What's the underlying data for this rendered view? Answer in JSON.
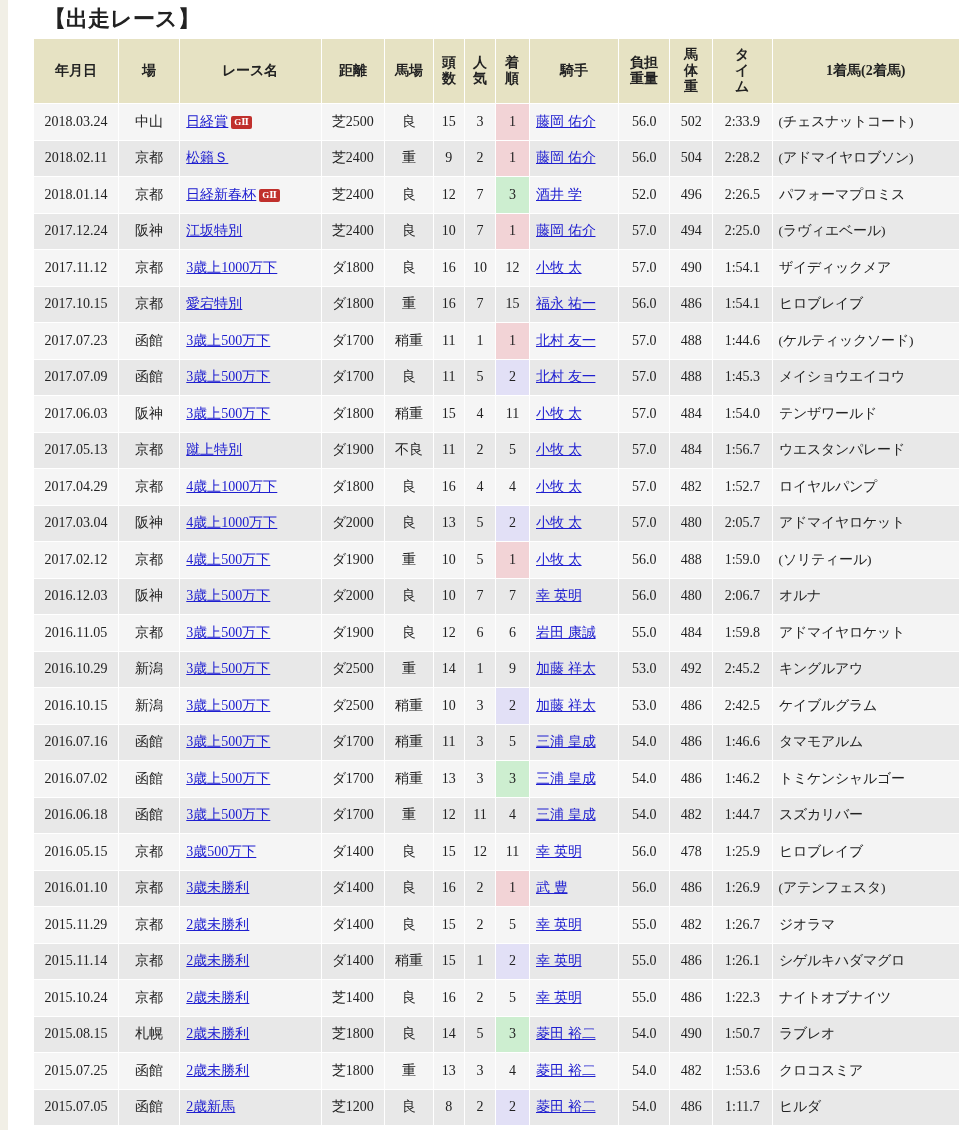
{
  "title": "【出走レース】",
  "columns": [
    "年月日",
    "場",
    "レース名",
    "距離",
    "馬場",
    "頭数",
    "人気",
    "着順",
    "騎手",
    "負担重量",
    "馬体重",
    "タイム",
    "1着馬(2着馬)"
  ],
  "rows": [
    {
      "date": "2018.03.24",
      "course": "中山",
      "race": "日経賞",
      "grade": "GⅡ",
      "distance": "芝2500",
      "track": "良",
      "runners": "15",
      "popularity": "3",
      "finish": {
        "text": "1",
        "color": "#f2d3d6"
      },
      "jockey": "藤岡 佑介",
      "weight": "56.0",
      "body_weight": "502",
      "time": "2:33.9",
      "winner": "(チェスナットコート)"
    },
    {
      "date": "2018.02.11",
      "course": "京都",
      "race": "松籟Ｓ",
      "distance": "芝2400",
      "track": "重",
      "runners": "9",
      "popularity": "2",
      "finish": {
        "text": "1",
        "color": "#f2d3d6"
      },
      "jockey": "藤岡 佑介",
      "weight": "56.0",
      "body_weight": "504",
      "time": "2:28.2",
      "winner": "(アドマイヤロブソン)"
    },
    {
      "date": "2018.01.14",
      "course": "京都",
      "race": "日経新春杯",
      "grade": "GⅡ",
      "distance": "芝2400",
      "track": "良",
      "runners": "12",
      "popularity": "7",
      "finish": {
        "text": "3",
        "color": "#cdeed0"
      },
      "jockey": "酒井 学",
      "weight": "52.0",
      "body_weight": "496",
      "time": "2:26.5",
      "winner": "パフォーマプロミス"
    },
    {
      "date": "2017.12.24",
      "course": "阪神",
      "race": "江坂特別",
      "distance": "芝2400",
      "track": "良",
      "runners": "10",
      "popularity": "7",
      "finish": {
        "text": "1",
        "color": "#f2d3d6"
      },
      "jockey": "藤岡 佑介",
      "weight": "57.0",
      "body_weight": "494",
      "time": "2:25.0",
      "winner": "(ラヴィエベール)"
    },
    {
      "date": "2017.11.12",
      "course": "京都",
      "race": "3歳上1000万下",
      "distance": "ダ1800",
      "track": "良",
      "runners": "16",
      "popularity": "10",
      "finish": {
        "text": "12"
      },
      "jockey": "小牧 太",
      "weight": "57.0",
      "body_weight": "490",
      "time": "1:54.1",
      "winner": "ザイディックメア"
    },
    {
      "date": "2017.10.15",
      "course": "京都",
      "race": "愛宕特別",
      "distance": "ダ1800",
      "track": "重",
      "runners": "16",
      "popularity": "7",
      "finish": {
        "text": "15"
      },
      "jockey": "福永 祐一",
      "weight": "56.0",
      "body_weight": "486",
      "time": "1:54.1",
      "winner": "ヒロブレイブ"
    },
    {
      "date": "2017.07.23",
      "course": "函館",
      "race": "3歳上500万下",
      "distance": "ダ1700",
      "track": "稍重",
      "runners": "11",
      "popularity": "1",
      "finish": {
        "text": "1",
        "color": "#f2d3d6"
      },
      "jockey": "北村 友一",
      "weight": "57.0",
      "body_weight": "488",
      "time": "1:44.6",
      "winner": "(ケルティックソード)"
    },
    {
      "date": "2017.07.09",
      "course": "函館",
      "race": "3歳上500万下",
      "distance": "ダ1700",
      "track": "良",
      "runners": "11",
      "popularity": "5",
      "finish": {
        "text": "2",
        "color": "#e2e0f6"
      },
      "jockey": "北村 友一",
      "weight": "57.0",
      "body_weight": "488",
      "time": "1:45.3",
      "winner": "メイショウエイコウ"
    },
    {
      "date": "2017.06.03",
      "course": "阪神",
      "race": "3歳上500万下",
      "distance": "ダ1800",
      "track": "稍重",
      "runners": "15",
      "popularity": "4",
      "finish": {
        "text": "11"
      },
      "jockey": "小牧 太",
      "weight": "57.0",
      "body_weight": "484",
      "time": "1:54.0",
      "winner": "テンザワールド"
    },
    {
      "date": "2017.05.13",
      "course": "京都",
      "race": "蹴上特別",
      "distance": "ダ1900",
      "track": "不良",
      "runners": "11",
      "popularity": "2",
      "finish": {
        "text": "5"
      },
      "jockey": "小牧 太",
      "weight": "57.0",
      "body_weight": "484",
      "time": "1:56.7",
      "winner": "ウエスタンパレード"
    },
    {
      "date": "2017.04.29",
      "course": "京都",
      "race": "4歳上1000万下",
      "distance": "ダ1800",
      "track": "良",
      "runners": "16",
      "popularity": "4",
      "finish": {
        "text": "4"
      },
      "jockey": "小牧 太",
      "weight": "57.0",
      "body_weight": "482",
      "time": "1:52.7",
      "winner": "ロイヤルパンプ"
    },
    {
      "date": "2017.03.04",
      "course": "阪神",
      "race": "4歳上1000万下",
      "distance": "ダ2000",
      "track": "良",
      "runners": "13",
      "popularity": "5",
      "finish": {
        "text": "2",
        "color": "#e2e0f6"
      },
      "jockey": "小牧 太",
      "weight": "57.0",
      "body_weight": "480",
      "time": "2:05.7",
      "winner": "アドマイヤロケット"
    },
    {
      "date": "2017.02.12",
      "course": "京都",
      "race": "4歳上500万下",
      "distance": "ダ1900",
      "track": "重",
      "runners": "10",
      "popularity": "5",
      "finish": {
        "text": "1",
        "color": "#f2d3d6"
      },
      "jockey": "小牧 太",
      "weight": "56.0",
      "body_weight": "488",
      "time": "1:59.0",
      "winner": "(ソリティール)"
    },
    {
      "date": "2016.12.03",
      "course": "阪神",
      "race": "3歳上500万下",
      "distance": "ダ2000",
      "track": "良",
      "runners": "10",
      "popularity": "7",
      "finish": {
        "text": "7"
      },
      "jockey": "幸 英明",
      "weight": "56.0",
      "body_weight": "480",
      "time": "2:06.7",
      "winner": "オルナ"
    },
    {
      "date": "2016.11.05",
      "course": "京都",
      "race": "3歳上500万下",
      "distance": "ダ1900",
      "track": "良",
      "runners": "12",
      "popularity": "6",
      "finish": {
        "text": "6"
      },
      "jockey": "岩田 康誠",
      "weight": "55.0",
      "body_weight": "484",
      "time": "1:59.8",
      "winner": "アドマイヤロケット"
    },
    {
      "date": "2016.10.29",
      "course": "新潟",
      "race": "3歳上500万下",
      "distance": "ダ2500",
      "track": "重",
      "runners": "14",
      "popularity": "1",
      "finish": {
        "text": "9"
      },
      "jockey": "加藤 祥太",
      "weight": "53.0",
      "body_weight": "492",
      "time": "2:45.2",
      "winner": "キングルアウ"
    },
    {
      "date": "2016.10.15",
      "course": "新潟",
      "race": "3歳上500万下",
      "distance": "ダ2500",
      "track": "稍重",
      "runners": "10",
      "popularity": "3",
      "finish": {
        "text": "2",
        "color": "#e2e0f6"
      },
      "jockey": "加藤 祥太",
      "weight": "53.0",
      "body_weight": "486",
      "time": "2:42.5",
      "winner": "ケイブルグラム"
    },
    {
      "date": "2016.07.16",
      "course": "函館",
      "race": "3歳上500万下",
      "distance": "ダ1700",
      "track": "稍重",
      "runners": "11",
      "popularity": "3",
      "finish": {
        "text": "5"
      },
      "jockey": "三浦 皇成",
      "weight": "54.0",
      "body_weight": "486",
      "time": "1:46.6",
      "winner": "タマモアルム"
    },
    {
      "date": "2016.07.02",
      "course": "函館",
      "race": "3歳上500万下",
      "distance": "ダ1700",
      "track": "稍重",
      "runners": "13",
      "popularity": "3",
      "finish": {
        "text": "3",
        "color": "#cdeed0"
      },
      "jockey": "三浦 皇成",
      "weight": "54.0",
      "body_weight": "486",
      "time": "1:46.2",
      "winner": "トミケンシャルゴー"
    },
    {
      "date": "2016.06.18",
      "course": "函館",
      "race": "3歳上500万下",
      "distance": "ダ1700",
      "track": "重",
      "runners": "12",
      "popularity": "11",
      "finish": {
        "text": "4"
      },
      "jockey": "三浦 皇成",
      "weight": "54.0",
      "body_weight": "482",
      "time": "1:44.7",
      "winner": "スズカリバー"
    },
    {
      "date": "2016.05.15",
      "course": "京都",
      "race": "3歳500万下",
      "distance": "ダ1400",
      "track": "良",
      "runners": "15",
      "popularity": "12",
      "finish": {
        "text": "11"
      },
      "jockey": "幸 英明",
      "weight": "56.0",
      "body_weight": "478",
      "time": "1:25.9",
      "winner": "ヒロブレイブ"
    },
    {
      "date": "2016.01.10",
      "course": "京都",
      "race": "3歳未勝利",
      "distance": "ダ1400",
      "track": "良",
      "runners": "16",
      "popularity": "2",
      "finish": {
        "text": "1",
        "color": "#f2d3d6"
      },
      "jockey": "武 豊",
      "weight": "56.0",
      "body_weight": "486",
      "time": "1:26.9",
      "winner": "(アテンフェスタ)"
    },
    {
      "date": "2015.11.29",
      "course": "京都",
      "race": "2歳未勝利",
      "distance": "ダ1400",
      "track": "良",
      "runners": "15",
      "popularity": "2",
      "finish": {
        "text": "5"
      },
      "jockey": "幸 英明",
      "weight": "55.0",
      "body_weight": "482",
      "time": "1:26.7",
      "winner": "ジオラマ"
    },
    {
      "date": "2015.11.14",
      "course": "京都",
      "race": "2歳未勝利",
      "distance": "ダ1400",
      "track": "稍重",
      "runners": "15",
      "popularity": "1",
      "finish": {
        "text": "2",
        "color": "#e2e0f6"
      },
      "jockey": "幸 英明",
      "weight": "55.0",
      "body_weight": "486",
      "time": "1:26.1",
      "winner": "シゲルキハダマグロ"
    },
    {
      "date": "2015.10.24",
      "course": "京都",
      "race": "2歳未勝利",
      "distance": "芝1400",
      "track": "良",
      "runners": "16",
      "popularity": "2",
      "finish": {
        "text": "5"
      },
      "jockey": "幸 英明",
      "weight": "55.0",
      "body_weight": "486",
      "time": "1:22.3",
      "winner": "ナイトオブナイツ"
    },
    {
      "date": "2015.08.15",
      "course": "札幌",
      "race": "2歳未勝利",
      "distance": "芝1800",
      "track": "良",
      "runners": "14",
      "popularity": "5",
      "finish": {
        "text": "3",
        "color": "#cdeed0"
      },
      "jockey": "菱田 裕二",
      "weight": "54.0",
      "body_weight": "490",
      "time": "1:50.7",
      "winner": "ラブレオ"
    },
    {
      "date": "2015.07.25",
      "course": "函館",
      "race": "2歳未勝利",
      "distance": "芝1800",
      "track": "重",
      "runners": "13",
      "popularity": "3",
      "finish": {
        "text": "4"
      },
      "jockey": "菱田 裕二",
      "weight": "54.0",
      "body_weight": "482",
      "time": "1:53.6",
      "winner": "クロコスミア"
    },
    {
      "date": "2015.07.05",
      "course": "函館",
      "race": "2歳新馬",
      "distance": "芝1200",
      "track": "良",
      "runners": "8",
      "popularity": "2",
      "finish": {
        "text": "2",
        "color": "#e2e0f6"
      },
      "jockey": "菱田 裕二",
      "weight": "54.0",
      "body_weight": "486",
      "time": "1:11.7",
      "winner": "ヒルダ"
    }
  ]
}
